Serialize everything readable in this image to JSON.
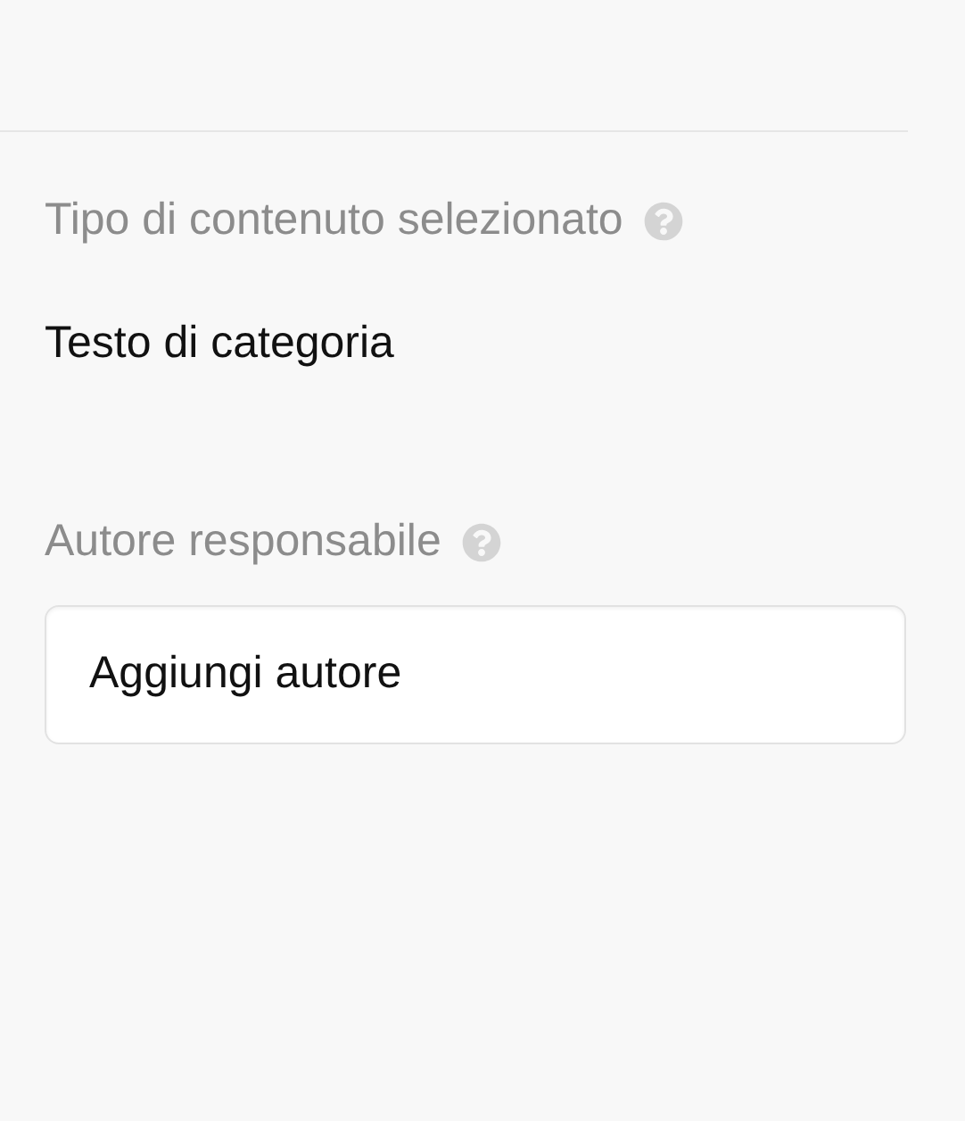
{
  "fields": [
    {
      "kind": "text",
      "label": "Tipo di contenuto selezionato",
      "value": "Testo di categoria"
    },
    {
      "kind": "button",
      "label": "Autore responsabile",
      "value": "Aggiungi autore"
    }
  ]
}
